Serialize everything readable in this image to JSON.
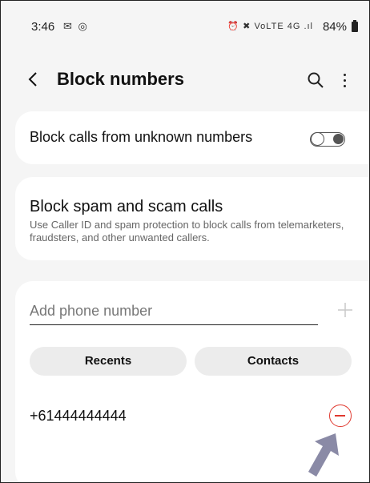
{
  "status_bar": {
    "time": "3:46",
    "left_icons": "✉ ◎",
    "right_icons": "⏰ ✖ VoLTE 4G .ıl",
    "battery": "84%"
  },
  "header": {
    "title": "Block numbers",
    "back_icon": "chevron-left-icon",
    "search_icon": "search-icon",
    "more_icon": "more-vertical-icon"
  },
  "block_unknown": {
    "label": "Block calls from unknown numbers",
    "toggle_on": false
  },
  "spam": {
    "title": "Block spam and scam calls",
    "description": "Use Caller ID and spam protection to block calls from telemarketers, fraudsters, and other unwanted callers."
  },
  "add_number": {
    "placeholder": "Add phone number",
    "value": ""
  },
  "buttons": {
    "recents": "Recents",
    "contacts": "Contacts"
  },
  "blocked_numbers": [
    {
      "number": "+61444444444"
    }
  ],
  "colors": {
    "remove_red": "#e0392f",
    "arrow_gray": "#8a8aa6",
    "background": "#f5f5f5"
  }
}
